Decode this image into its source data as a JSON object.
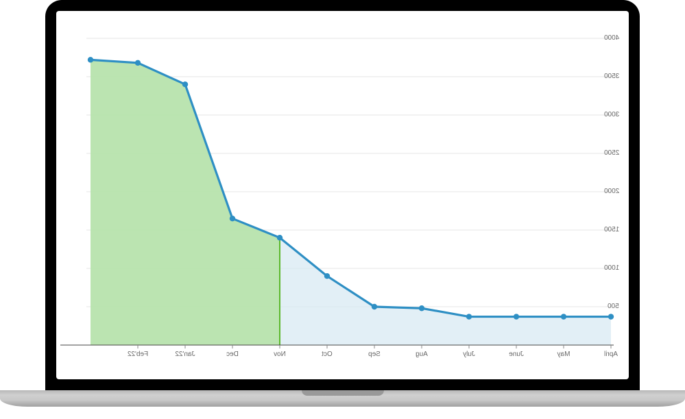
{
  "chart_data": {
    "type": "area",
    "categories": [
      "April",
      "May",
      "June",
      "July",
      "Aug",
      "Sep",
      "Oct",
      "Nov",
      "Dec",
      "Jan'22",
      "Feb'22"
    ],
    "values": [
      370,
      370,
      370,
      370,
      480,
      500,
      900,
      1400,
      1650,
      3400,
      3680,
      3720
    ],
    "ylabel": "",
    "xlabel": "",
    "title": "",
    "ylim": [
      0,
      4000
    ],
    "y_ticks": [
      500,
      1000,
      1500,
      2000,
      2500,
      3000,
      3500,
      4000
    ],
    "highlight_start_index": 7,
    "fill_colors": {
      "base": "#d5e8f2",
      "highlight": "#b4e2a5"
    },
    "line_color": "#2e8fc4",
    "marker_color": "#2e8fc4",
    "highlight_rule_color": "#5cb82c"
  }
}
